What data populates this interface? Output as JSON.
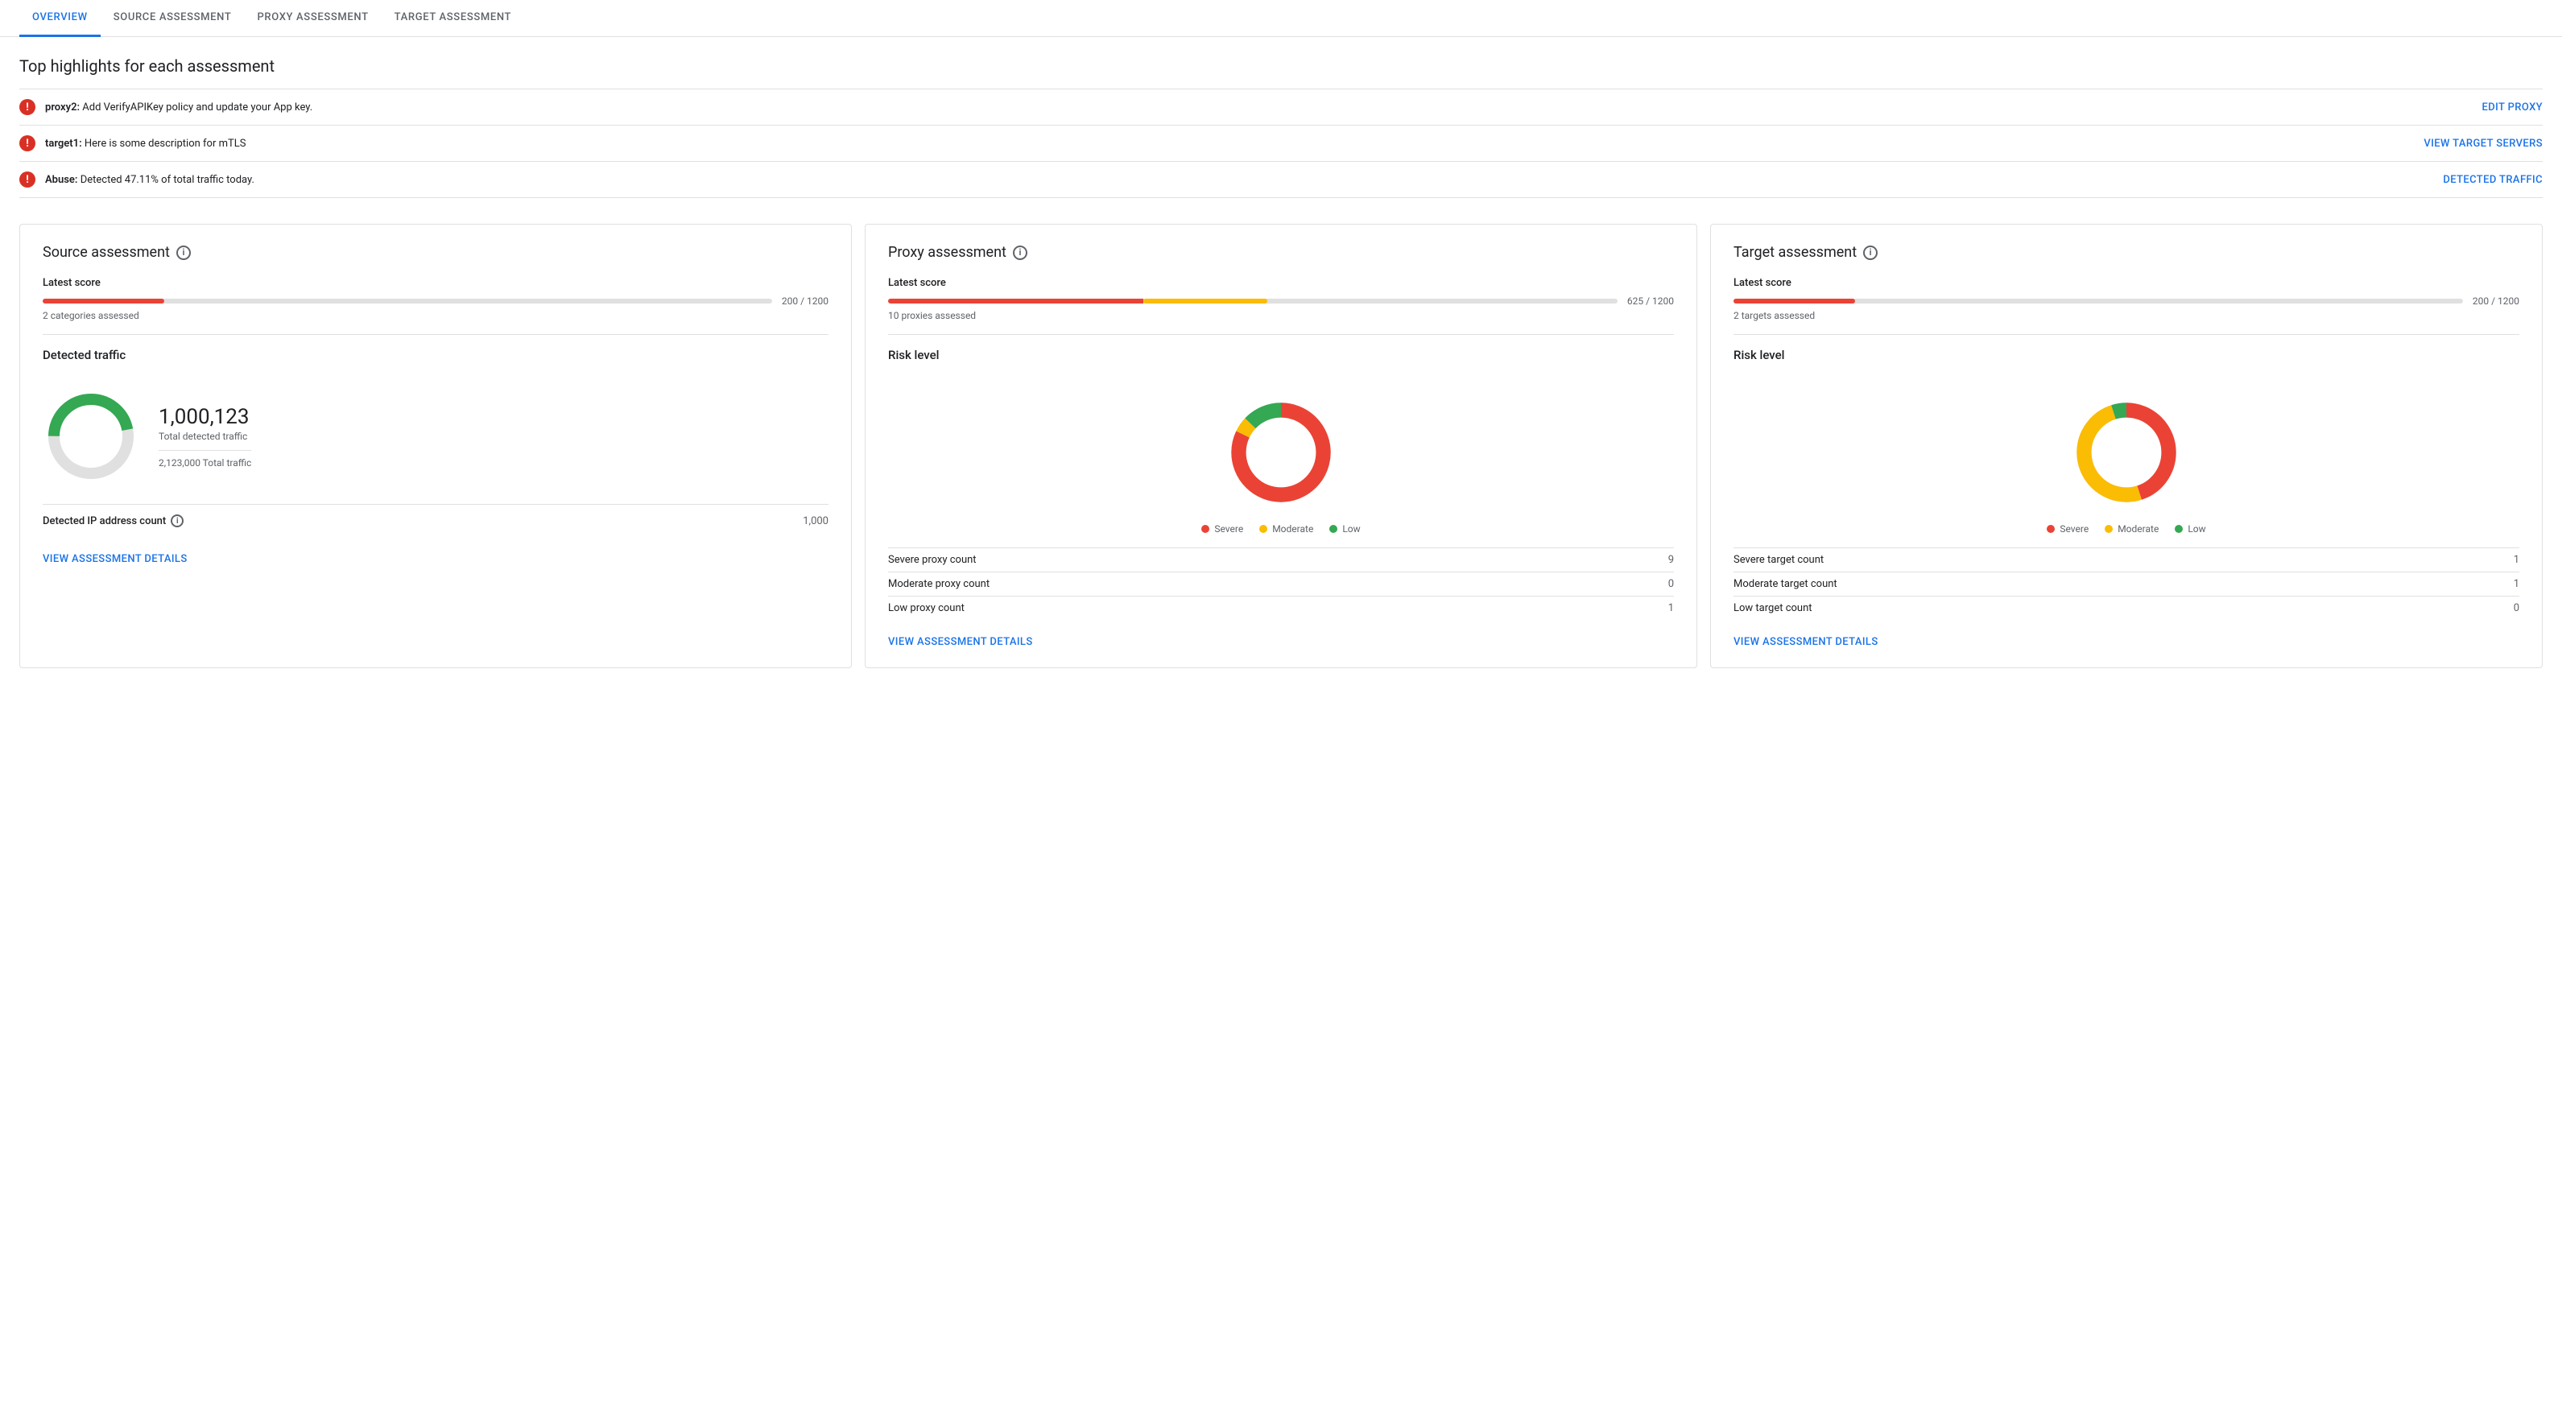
{
  "tabs": [
    {
      "id": "overview",
      "label": "OVERVIEW",
      "active": true
    },
    {
      "id": "source",
      "label": "SOURCE ASSESSMENT",
      "active": false
    },
    {
      "id": "proxy",
      "label": "PROXY ASSESSMENT",
      "active": false
    },
    {
      "id": "target",
      "label": "TARGET ASSESSMENT",
      "active": false
    }
  ],
  "highlights": {
    "title": "Top highlights for each assessment",
    "items": [
      {
        "text_bold": "proxy2:",
        "text": " Add VerifyAPIKey policy and update your App key.",
        "link_label": "EDIT PROXY",
        "link_id": "edit-proxy"
      },
      {
        "text_bold": "target1:",
        "text": " Here is some description for mTLS",
        "link_label": "VIEW TARGET SERVERS",
        "link_id": "view-target-servers"
      },
      {
        "text_bold": "Abuse:",
        "text": " Detected 47.11% of total traffic today.",
        "link_label": "DETECTED TRAFFIC",
        "link_id": "detected-traffic"
      }
    ]
  },
  "cards": {
    "source": {
      "title": "Source assessment",
      "latest_score_label": "Latest score",
      "score_value": "200",
      "score_max": "1200",
      "score_display": "200 / 1200",
      "score_fill_pct": 16.7,
      "score_fill_color": "#ea4335",
      "categories_assessed": "2 categories assessed",
      "detected_traffic_label": "Detected traffic",
      "total_detected": "1,000,123",
      "total_detected_label": "Total detected traffic",
      "total_traffic": "2,123,000 Total traffic",
      "ip_count_label": "Detected IP address count",
      "ip_count_value": "1,000",
      "view_link": "VIEW ASSESSMENT DETAILS",
      "donut": {
        "detected_pct": 47,
        "detected_color": "#34a853",
        "remaining_color": "#e0e0e0"
      }
    },
    "proxy": {
      "title": "Proxy assessment",
      "latest_score_label": "Latest score",
      "score_value": "625",
      "score_max": "1200",
      "score_display": "625 / 1200",
      "score_fill_pct": 52.1,
      "score_fill_color": "#ea4335",
      "score_fill2_pct": 10,
      "score_fill2_color": "#fbbc04",
      "proxies_assessed": "10 proxies assessed",
      "risk_level_label": "Risk level",
      "legend": [
        {
          "label": "Severe",
          "color": "#ea4335"
        },
        {
          "label": "Moderate",
          "color": "#fbbc04"
        },
        {
          "label": "Low",
          "color": "#34a853"
        }
      ],
      "counts": [
        {
          "label": "Severe proxy count",
          "value": "9"
        },
        {
          "label": "Moderate proxy count",
          "value": "0"
        },
        {
          "label": "Low proxy count",
          "value": "1"
        }
      ],
      "view_link": "VIEW ASSESSMENT DETAILS",
      "donut": {
        "severe_pct": 82,
        "moderate_pct": 5,
        "low_pct": 13,
        "severe_color": "#ea4335",
        "moderate_color": "#fbbc04",
        "low_color": "#34a853"
      }
    },
    "target": {
      "title": "Target assessment",
      "latest_score_label": "Latest score",
      "score_value": "200",
      "score_max": "1200",
      "score_display": "200 / 1200",
      "score_fill_pct": 16.7,
      "score_fill_color": "#ea4335",
      "targets_assessed": "2 targets assessed",
      "risk_level_label": "Risk level",
      "legend": [
        {
          "label": "Severe",
          "color": "#ea4335"
        },
        {
          "label": "Moderate",
          "color": "#fbbc04"
        },
        {
          "label": "Low",
          "color": "#34a853"
        }
      ],
      "counts": [
        {
          "label": "Severe target count",
          "value": "1"
        },
        {
          "label": "Moderate target count",
          "value": "1"
        },
        {
          "label": "Low target count",
          "value": "0"
        }
      ],
      "view_link": "VIEW ASSESSMENT DETAILS",
      "donut": {
        "severe_pct": 45,
        "moderate_pct": 50,
        "low_pct": 5,
        "severe_color": "#ea4335",
        "moderate_color": "#fbbc04",
        "low_color": "#34a853"
      }
    }
  },
  "icons": {
    "info": "i",
    "error": "!"
  }
}
